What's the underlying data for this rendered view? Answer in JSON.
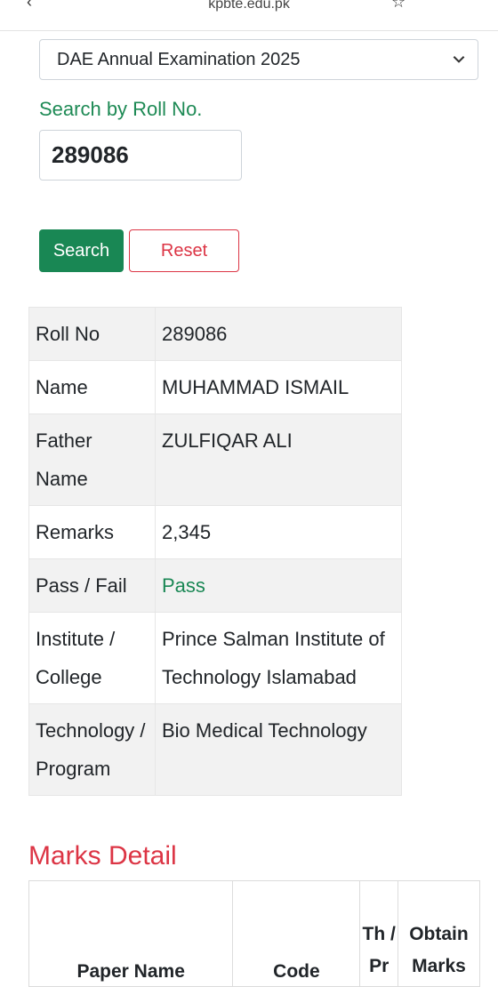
{
  "browser": {
    "url": "kpbte.edu.pk"
  },
  "exam_select": {
    "selected": "DAE Annual Examination 2025"
  },
  "search": {
    "label": "Search by Roll No.",
    "roll_value": "289086",
    "search_button": "Search",
    "reset_button": "Reset"
  },
  "result": {
    "rows": [
      {
        "key": "Roll No",
        "value": "289086"
      },
      {
        "key": "Name",
        "value": "MUHAMMAD ISMAIL"
      },
      {
        "key": "Father Name",
        "value": "ZULFIQAR ALI"
      },
      {
        "key": "Remarks",
        "value": "2,345"
      },
      {
        "key": "Pass / Fail",
        "value": "Pass"
      },
      {
        "key": "Institute / College",
        "value": "Prince Salman Institute of Technology Islamabad"
      },
      {
        "key": "Technology / Program",
        "value": "Bio Medical Technology"
      }
    ]
  },
  "marks": {
    "title": "Marks Detail",
    "headers": [
      "Paper Name",
      "Code",
      "Th / Pr",
      "Obtain Marks"
    ]
  },
  "colors": {
    "primary_green": "#198754",
    "danger_red": "#dc3545"
  }
}
